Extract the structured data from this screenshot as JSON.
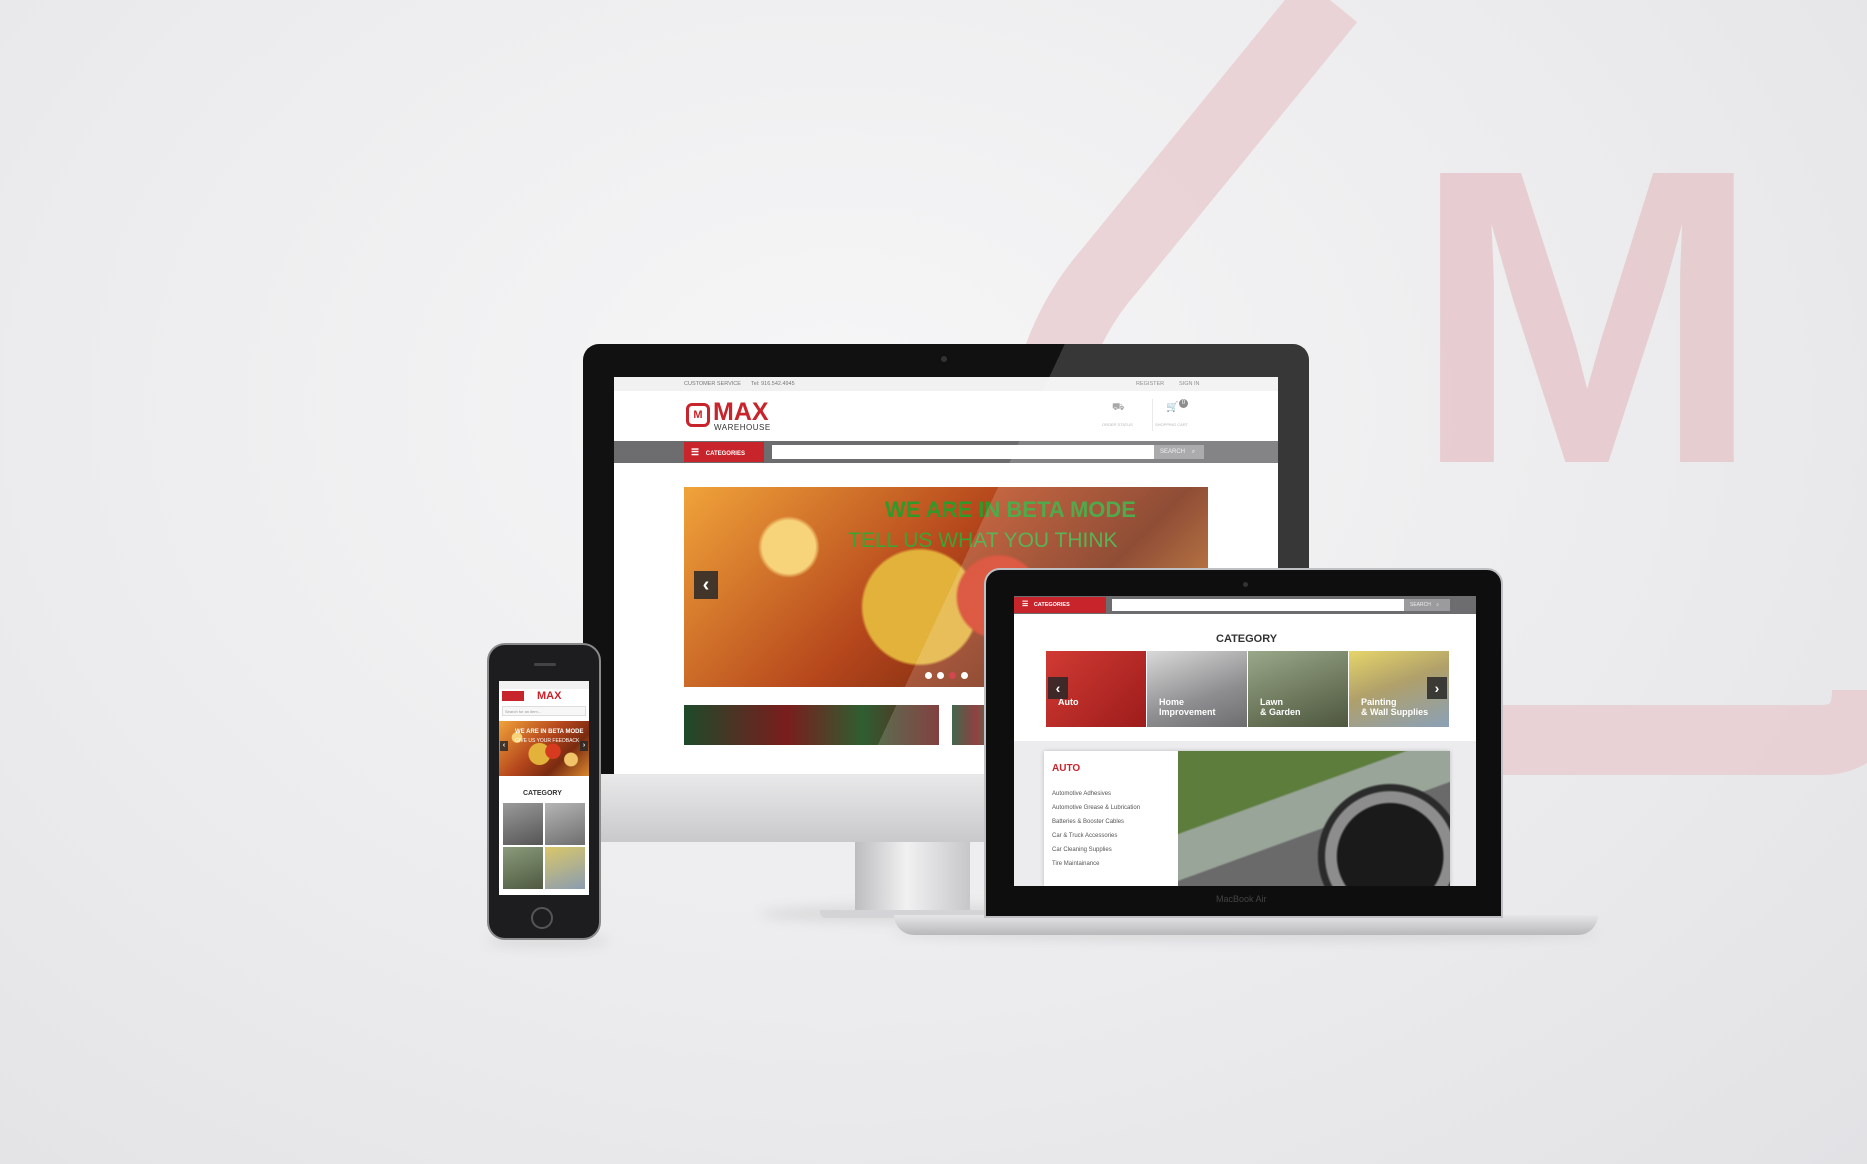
{
  "brand": {
    "name": "MAX",
    "sub": "WAREHOUSE",
    "badge": "M",
    "bg_letter": "M",
    "color": "#c8242b"
  },
  "imac_site": {
    "topbar": {
      "customer_service": "CUSTOMER SERVICE",
      "tel": "Tel: 916.542.4945",
      "register": "REGISTER",
      "sign_in": "SIGN IN"
    },
    "header": {
      "order_status_icon": "truck-icon",
      "order_status": "ORDER STATUS",
      "cart_icon": "cart-icon",
      "cart_count": "0",
      "cart_label": "SHOPPING CART"
    },
    "nav": {
      "categories": "CATEGORIES",
      "search_value": "",
      "search_button": "SEARCH"
    },
    "banner": {
      "line1": "WE ARE IN BETA MODE",
      "line2": "TELL US WHAT YOU THINK",
      "prev": "‹",
      "dots": 4,
      "active_dot": 3
    }
  },
  "macbook_site": {
    "nav": {
      "categories": "CATEGORIES",
      "search_button": "SEARCH"
    },
    "category_heading": "CATEGORY",
    "tiles": [
      {
        "label": "Auto",
        "color": "#c8242b"
      },
      {
        "label": "Home\nImprovement",
        "color": "#8e8e90"
      },
      {
        "label": "Lawn\n& Garden",
        "color": "#6f7a5e"
      },
      {
        "label": "Painting\n& Wall Supplies",
        "color": "#b0a06a"
      }
    ],
    "prev": "‹",
    "next": "›",
    "panel": {
      "title": "AUTO",
      "items": [
        "Automotive Adhesives",
        "Automotive Grease & Lubrication",
        "Batteries & Booster Cables",
        "Car & Truck Accessories",
        "Car Cleaning Supplies",
        "Tire Maintainance"
      ]
    },
    "device_label": "MacBook Air"
  },
  "phone_site": {
    "banner_line1": "WE ARE IN BETA MODE",
    "banner_line2": "GIVE US YOUR FEEDBACK",
    "search_placeholder": "Search for an item...",
    "category_heading": "CATEGORY"
  }
}
